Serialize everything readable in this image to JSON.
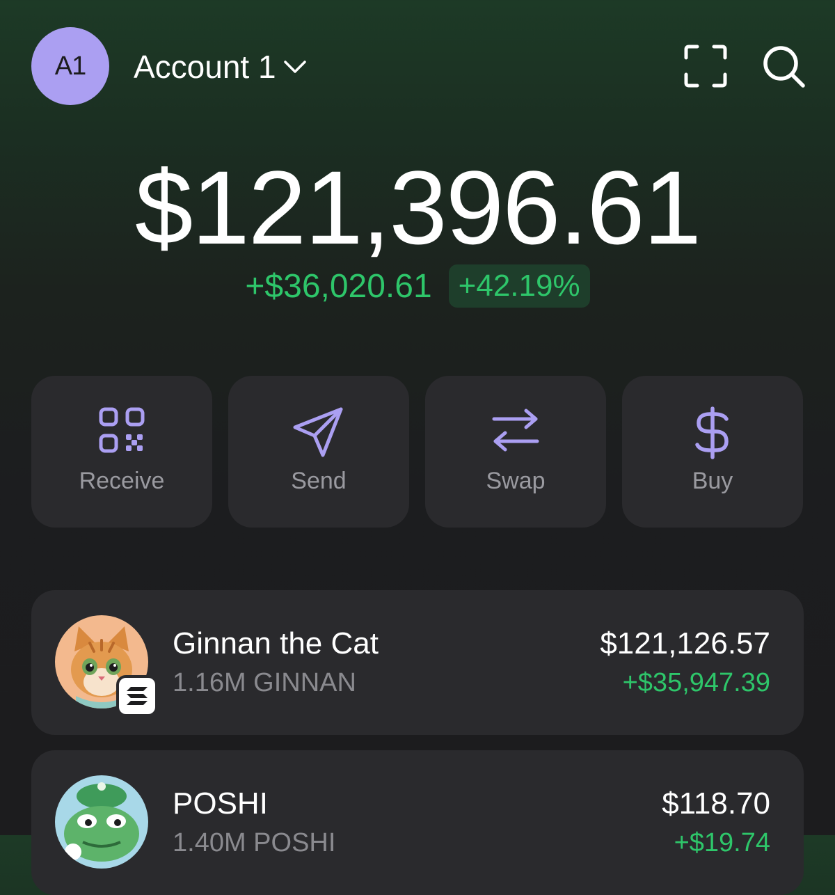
{
  "header": {
    "avatar_initials": "A1",
    "account_name": "Account 1",
    "icons": [
      "chevron-down-icon",
      "scan-icon",
      "search-icon"
    ]
  },
  "portfolio": {
    "balance": "$121,396.61",
    "change_amount": "+$36,020.61",
    "change_percent": "+42.19%"
  },
  "actions": [
    {
      "label": "Receive",
      "icon": "qr-code-icon"
    },
    {
      "label": "Send",
      "icon": "send-icon"
    },
    {
      "label": "Swap",
      "icon": "swap-icon"
    },
    {
      "label": "Buy",
      "icon": "dollar-icon"
    }
  ],
  "tokens": [
    {
      "name": "Ginnan the Cat",
      "quantity": "1.16M GINNAN",
      "value": "$121,126.57",
      "change": "+$35,947.39",
      "chain_icon": "solana-icon"
    },
    {
      "name": "POSHI",
      "quantity": "1.40M POSHI",
      "value": "$118.70",
      "change": "+$19.74"
    }
  ],
  "colors": {
    "accent_purple": "#ab9ff2",
    "positive_green": "#2ec66a",
    "card_background": "#2a2a2d"
  }
}
